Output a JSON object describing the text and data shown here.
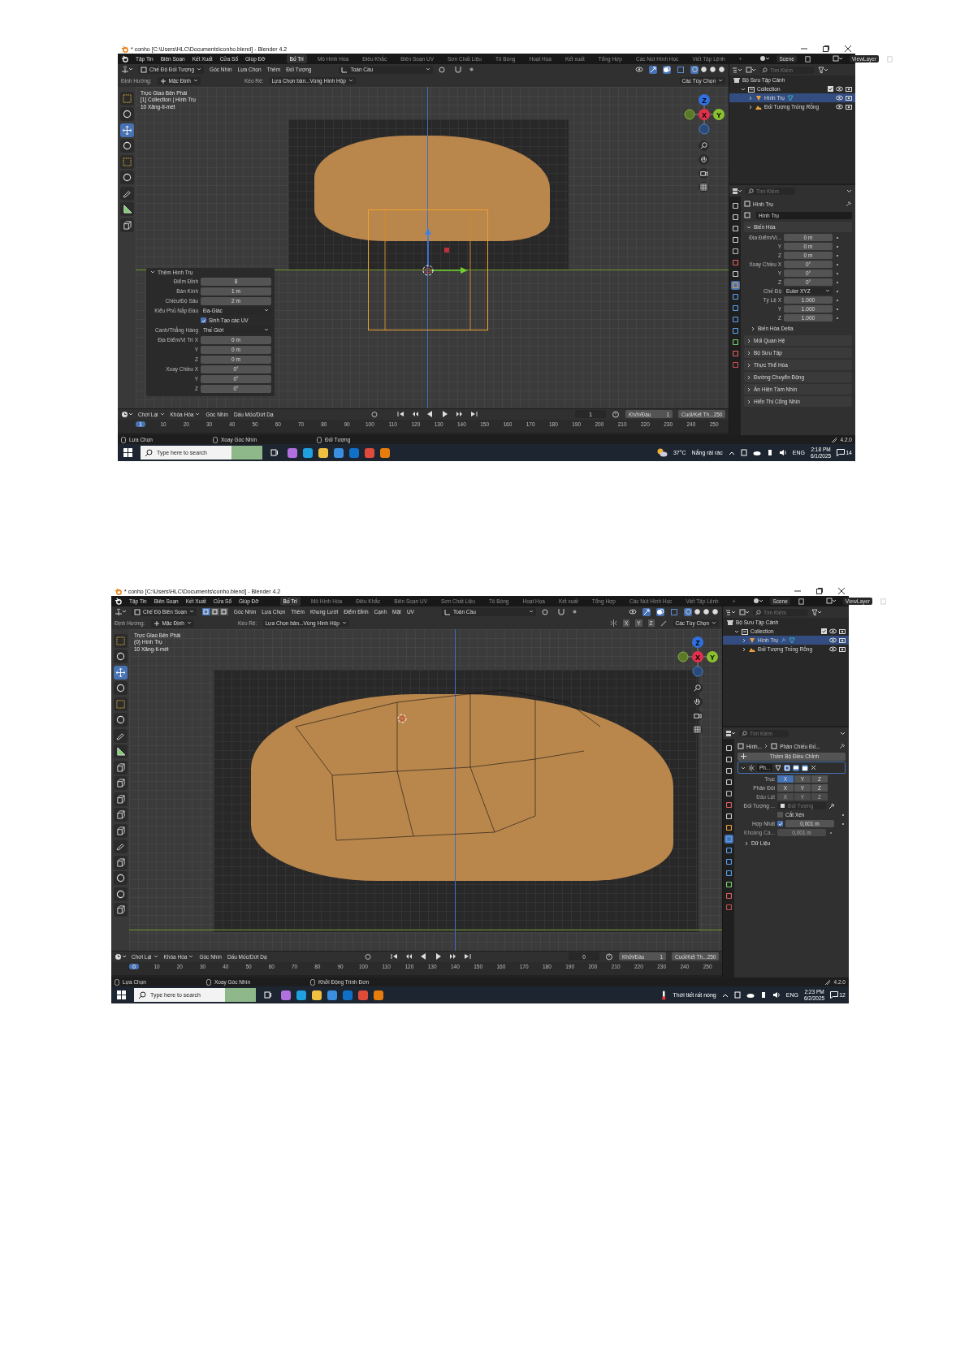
{
  "screenshots": [
    {
      "title": "* conho [C:\\Users\\HLC\\Documents\\conho.blend] - Blender 4.2",
      "menus": [
        "Tập Tin",
        "Biên Soạn",
        "Kết Xuất",
        "Cửa Sổ",
        "Giúp Đỡ"
      ],
      "workspaces": [
        {
          "label": "Bố Trí",
          "selected": true
        },
        {
          "label": "Mô Hình Hóa",
          "selected": false
        },
        {
          "label": "Điêu Khắc",
          "selected": false
        },
        {
          "label": "Biên Soạn UV",
          "selected": false
        },
        {
          "label": "Sơn Chất Liệu",
          "selected": false
        },
        {
          "label": "Tô Bóng",
          "selected": false
        },
        {
          "label": "Hoạt Họa",
          "selected": false
        },
        {
          "label": "Kết xuất",
          "selected": false
        },
        {
          "label": "Tổng Hợp",
          "selected": false
        },
        {
          "label": "Các Nút Hình Học",
          "selected": false
        },
        {
          "label": "Viết Tập Lệnh",
          "selected": false
        },
        {
          "label": "+",
          "selected": false
        }
      ],
      "scene": "Scene",
      "view_layer": "ViewLayer",
      "mode": "Chế Độ Đối Tượng",
      "header_menus": [
        "Góc Nhìn",
        "Lựa Chọn",
        "Thêm",
        "Đối Tượng"
      ],
      "orientation": "Toàn Cầu",
      "shading": [
        {
          "selected": true
        },
        {
          "selected": false
        },
        {
          "selected": false
        },
        {
          "selected": false
        }
      ],
      "tool_settings": {
        "orientation_label": "Định Hướng:",
        "orientation": "Mặc Định",
        "drag_label": "Kéo Rê:",
        "drag": "Lựa Chọn bản...Vùng Hình Hộp",
        "options": "Các Tùy Chọn"
      },
      "overlay_text": [
        "Trực Giao Bên Phải",
        "[1] Collection | Hình Trụ",
        "10 Xăng-ti-mét"
      ],
      "tools": [
        {
          "kind": "select",
          "selected": false
        },
        {
          "kind": "cursor",
          "selected": false
        },
        {
          "kind": "move",
          "selected": true
        },
        {
          "kind": "rotate",
          "selected": false
        },
        {
          "kind": "scale",
          "selected": false
        },
        {
          "kind": "transform",
          "selected": false
        },
        {
          "kind": "annotate",
          "selected": false
        },
        {
          "kind": "measure",
          "selected": false
        },
        {
          "kind": "add",
          "selected": false
        }
      ],
      "viewport": {
        "kind": "object"
      },
      "gizmo": [
        "X",
        "Y",
        "Z"
      ],
      "operator_panel": {
        "title": "Thêm Hình Trụ",
        "expanded": true,
        "rows": [
          {
            "kind": "field",
            "label": "Điểm Đỉnh",
            "value": "8"
          },
          {
            "kind": "field",
            "label": "Bán Kính",
            "value": "1 m"
          },
          {
            "kind": "field",
            "label": "Chiều/Độ Sâu",
            "value": "2 m"
          },
          {
            "kind": "select",
            "label": "Kiểu Phủ Nắp Đầu",
            "value": "Đa-Giác"
          },
          {
            "kind": "check",
            "label": "Sinh Tạo các UV",
            "checked": true
          },
          {
            "kind": "select",
            "label": "Canh/Thẳng Hàng",
            "value": "Thế Giới"
          },
          {
            "kind": "field",
            "label": "Địa Điểm/Vị Trí X",
            "value": "0 m"
          },
          {
            "kind": "field",
            "label": "Y",
            "value": "0 m"
          },
          {
            "kind": "field",
            "label": "Z",
            "value": "0 m"
          },
          {
            "kind": "field",
            "label": "Xoay Chiều X",
            "value": "0°"
          },
          {
            "kind": "field",
            "label": "Y",
            "value": "0°"
          },
          {
            "kind": "field",
            "label": "Z",
            "value": "0°"
          }
        ]
      },
      "outliner": {
        "search": "Tìm Kiếm",
        "items": [
          {
            "label": "Bộ Sưu Tập Cảnh",
            "kind": "scene",
            "selected": false,
            "children": [
              {
                "label": "Collection",
                "kind": "collection",
                "expanded": true,
                "checked": true,
                "selected": false,
                "children": [
                  {
                    "label": "Hình Trụ",
                    "kind": "mesh",
                    "expanded": false,
                    "selected": true,
                    "modifier": false
                  },
                  {
                    "label": "Đối Tượng Trống Rỗng",
                    "kind": "empty",
                    "expanded": false,
                    "selected": false
                  }
                ]
              }
            ]
          }
        ]
      },
      "properties": {
        "search": "Tìm Kiếm",
        "breadcrumb": [
          "Hình Trụ"
        ],
        "tabs": [
          {
            "selected": false
          },
          {
            "selected": false
          },
          {
            "selected": false
          },
          {
            "selected": false
          },
          {
            "selected": false
          },
          {
            "selected": false
          },
          {
            "selected": false
          },
          {
            "selected": true
          },
          {
            "selected": false
          },
          {
            "selected": false
          },
          {
            "selected": false
          },
          {
            "selected": false
          },
          {
            "selected": false
          },
          {
            "selected": false
          },
          {
            "selected": false
          }
        ],
        "rows": [
          {
            "kind": "name",
            "value": "Hình Trụ"
          },
          {
            "kind": "panel",
            "label": "Biến Hóa",
            "expanded": true
          },
          {
            "kind": "field",
            "label": "Địa Điểm/Vị...",
            "value": "0 m"
          },
          {
            "kind": "field",
            "label": "Y",
            "value": "0 m"
          },
          {
            "kind": "field",
            "label": "Z",
            "value": "0 m"
          },
          {
            "kind": "field",
            "label": "Xoay Chiều X",
            "value": "0°"
          },
          {
            "kind": "field",
            "label": "Y",
            "value": "0°"
          },
          {
            "kind": "field",
            "label": "Z",
            "value": "0°"
          },
          {
            "kind": "select",
            "label": "Chế Độ",
            "value": "Euler XYZ"
          },
          {
            "kind": "field",
            "label": "Tỷ Lệ X",
            "value": "1.000"
          },
          {
            "kind": "field",
            "label": "Y",
            "value": "1.000"
          },
          {
            "kind": "field",
            "label": "Z",
            "value": "1.000"
          },
          {
            "kind": "subpanel",
            "label": "Biến Hóa Delta",
            "expanded": false
          },
          {
            "kind": "panel",
            "label": "Mối Quan Hệ",
            "expanded": false
          },
          {
            "kind": "panel",
            "label": "Bộ Sưu Tập",
            "expanded": false
          },
          {
            "kind": "panel",
            "label": "Thực Thể Hóa",
            "expanded": false
          },
          {
            "kind": "panel",
            "label": "Đường Chuyển Động",
            "expanded": false
          },
          {
            "kind": "panel",
            "label": "Ẩn Hiện Tầm Nhìn",
            "expanded": false
          },
          {
            "kind": "panel",
            "label": "Hiển Thị Cổng Nhìn",
            "expanded": false
          }
        ]
      },
      "timeline": {
        "menus": [
          {
            "label": "Chơi Lại",
            "dropdown": true
          },
          {
            "label": "Khóa Hóa",
            "dropdown": true
          },
          {
            "label": "Góc Nhìn",
            "dropdown": false
          },
          {
            "label": "Dấu Mốc/Dứt Dạ",
            "dropdown": false
          }
        ],
        "current_frame": "1",
        "start_label": "Khởi/Đầu",
        "start": "1",
        "end_label": "Cuối/Kết Th...",
        "end": "250",
        "ruler": [
          {
            "label": "1",
            "selected": true
          },
          {
            "label": "10",
            "selected": false
          },
          {
            "label": "20",
            "selected": false
          },
          {
            "label": "30",
            "selected": false
          },
          {
            "label": "40",
            "selected": false
          },
          {
            "label": "50",
            "selected": false
          },
          {
            "label": "60",
            "selected": false
          },
          {
            "label": "70",
            "selected": false
          },
          {
            "label": "80",
            "selected": false
          },
          {
            "label": "90",
            "selected": false
          },
          {
            "label": "100",
            "selected": false
          },
          {
            "label": "110",
            "selected": false
          },
          {
            "label": "120",
            "selected": false
          },
          {
            "label": "130",
            "selected": false
          },
          {
            "label": "140",
            "selected": false
          },
          {
            "label": "150",
            "selected": false
          },
          {
            "label": "160",
            "selected": false
          },
          {
            "label": "170",
            "selected": false
          },
          {
            "label": "180",
            "selected": false
          },
          {
            "label": "190",
            "selected": false
          },
          {
            "label": "200",
            "selected": false
          },
          {
            "label": "210",
            "selected": false
          },
          {
            "label": "220",
            "selected": false
          },
          {
            "label": "230",
            "selected": false
          },
          {
            "label": "240",
            "selected": false
          },
          {
            "label": "250",
            "selected": false
          }
        ]
      },
      "status_bar": {
        "items": [
          "Lựa Chọn",
          "Xoay Góc Nhìn",
          "Đối Tượng"
        ],
        "version": "4.2.0"
      },
      "taskbar": {
        "search_placeholder": "Type here to search",
        "temperature": "37°C",
        "weather": "Nắng rải rác",
        "language": "ENG",
        "time": "2:18 PM",
        "date": "6/1/2025",
        "notifications": "14"
      }
    },
    {
      "title": "* conho [C:\\Users\\HLC\\Documents\\conho.blend] - Blender 4.2",
      "menus": [
        "Tập Tin",
        "Biên Soạn",
        "Kết Xuất",
        "Cửa Sổ",
        "Giúp Đỡ"
      ],
      "workspaces": [
        {
          "label": "Bố Trí",
          "selected": true
        },
        {
          "label": "Mô Hình Hóa",
          "selected": false
        },
        {
          "label": "Điêu Khắc",
          "selected": false
        },
        {
          "label": "Biên Soạn UV",
          "selected": false
        },
        {
          "label": "Sơn Chất Liệu",
          "selected": false
        },
        {
          "label": "Tô Bóng",
          "selected": false
        },
        {
          "label": "Hoạt Họa",
          "selected": false
        },
        {
          "label": "Kết xuất",
          "selected": false
        },
        {
          "label": "Tổng Hợp",
          "selected": false
        },
        {
          "label": "Các Nút Hình Học",
          "selected": false
        },
        {
          "label": "Viết Tập Lệnh",
          "selected": false
        },
        {
          "label": "+",
          "selected": false
        }
      ],
      "scene": "Scene",
      "view_layer": "ViewLayer",
      "mode": "Chế Độ Biên Soạn",
      "select_modes": [
        {
          "selected": true
        },
        {
          "selected": false
        },
        {
          "selected": false
        }
      ],
      "header_menus": [
        "Góc Nhìn",
        "Lựa Chọn",
        "Thêm",
        "Khung Lưới",
        "Điểm Đỉnh",
        "Cạnh",
        "Mặt",
        "UV"
      ],
      "orientation": "Toàn Cầu",
      "shading": [
        {
          "selected": true
        },
        {
          "selected": false
        },
        {
          "selected": false
        },
        {
          "selected": false
        }
      ],
      "tool_settings": {
        "orientation_label": "Định Hướng:",
        "orientation": "Mặc Định",
        "drag_label": "Kéo Rê:",
        "drag": "Lựa Chọn bản...Vùng Hình Hộp",
        "mirror_axes": [
          "X",
          "Y",
          "Z"
        ],
        "options": "Các Tùy Chọn"
      },
      "overlay_text": [
        "Trực Giao Bên Phải",
        "(0) Hình Trụ",
        "10 Xăng-ti-mét"
      ],
      "tools": [
        {
          "kind": "select",
          "selected": false
        },
        {
          "kind": "cursor",
          "selected": false
        },
        {
          "kind": "move",
          "selected": true
        },
        {
          "kind": "rotate",
          "selected": false
        },
        {
          "kind": "scale",
          "selected": false
        },
        {
          "kind": "transform",
          "selected": false
        },
        {
          "kind": "annotate",
          "selected": false
        },
        {
          "kind": "measure",
          "selected": false
        },
        {
          "kind": "add",
          "selected": false
        },
        {
          "kind": "extrude",
          "selected": false
        },
        {
          "kind": "inset",
          "selected": false
        },
        {
          "kind": "bevel",
          "selected": false
        },
        {
          "kind": "loopcut",
          "selected": false
        },
        {
          "kind": "knife",
          "selected": false
        },
        {
          "kind": "polybuild",
          "selected": false
        },
        {
          "kind": "spin",
          "selected": false
        },
        {
          "kind": "smooth",
          "selected": false
        },
        {
          "kind": "shrink",
          "selected": false
        }
      ],
      "viewport": {
        "kind": "edit"
      },
      "gizmo": [
        "X",
        "Y",
        "Z"
      ],
      "outliner": {
        "search": "Tìm Kiếm",
        "items": [
          {
            "label": "Bộ Sưu Tập Cảnh",
            "kind": "scene",
            "selected": false,
            "children": [
              {
                "label": "Collection",
                "kind": "collection",
                "expanded": true,
                "checked": true,
                "selected": false,
                "children": [
                  {
                    "label": "Hình Trụ",
                    "kind": "mesh",
                    "expanded": false,
                    "selected": true,
                    "modifier": true
                  },
                  {
                    "label": "Đối Tượng Trống Rỗng",
                    "kind": "empty",
                    "expanded": false,
                    "selected": false
                  }
                ]
              }
            ]
          }
        ]
      },
      "properties": {
        "search": "Tìm Kiếm",
        "breadcrumb": [
          "Hình...",
          "Phản Chiếu Đố..."
        ],
        "tabs": [
          {
            "selected": false
          },
          {
            "selected": false
          },
          {
            "selected": false
          },
          {
            "selected": false
          },
          {
            "selected": false
          },
          {
            "selected": false
          },
          {
            "selected": false
          },
          {
            "selected": false
          },
          {
            "selected": true
          },
          {
            "selected": false
          },
          {
            "selected": false
          },
          {
            "selected": false
          },
          {
            "selected": false
          },
          {
            "selected": false
          },
          {
            "selected": false
          }
        ],
        "rows": [
          {
            "kind": "add",
            "label": "Thêm Bộ Điều Chỉnh"
          },
          {
            "kind": "modifier",
            "label": "Ph...",
            "expanded": true
          },
          {
            "kind": "axes",
            "label": "Trục",
            "disabled": false,
            "buttons": [
              {
                "label": "X",
                "selected": true
              },
              {
                "label": "Y",
                "selected": false
              },
              {
                "label": "Z",
                "selected": false
              }
            ]
          },
          {
            "kind": "axes",
            "label": "Phân Đôi",
            "disabled": false,
            "buttons": [
              {
                "label": "X",
                "selected": false
              },
              {
                "label": "Y",
                "selected": false
              },
              {
                "label": "Z",
                "selected": false
              }
            ]
          },
          {
            "kind": "axes",
            "label": "Đảo Lật",
            "disabled": true,
            "buttons": [
              {
                "label": "X",
                "selected": false
              },
              {
                "label": "Y",
                "selected": false
              },
              {
                "label": "Z",
                "selected": false
              }
            ]
          },
          {
            "kind": "object",
            "label": "Đối Tượng ...",
            "placeholder": "Đối Tượng"
          },
          {
            "kind": "check",
            "label": "Cắt Xén",
            "checked": false
          },
          {
            "kind": "check_field",
            "label": "Hợp Nhất",
            "checked": true,
            "value": "0,001 m"
          },
          {
            "kind": "field",
            "label": "Khoảng Cá...",
            "value": "0,001 m",
            "disabled": true
          },
          {
            "kind": "subpanel",
            "label": "Dữ Liệu",
            "expanded": false
          }
        ]
      },
      "timeline": {
        "menus": [
          {
            "label": "Chơi Lại",
            "dropdown": true
          },
          {
            "label": "Khóa Hóa",
            "dropdown": true
          },
          {
            "label": "Góc Nhìn",
            "dropdown": false
          },
          {
            "label": "Dấu Mốc/Dứt Dạ",
            "dropdown": false
          }
        ],
        "current_frame": "0",
        "start_label": "Khởi/Đầu",
        "start": "1",
        "end_label": "Cuối/Kết Th...",
        "end": "250",
        "ruler": [
          {
            "label": "0",
            "selected": true
          },
          {
            "label": "10",
            "selected": false
          },
          {
            "label": "20",
            "selected": false
          },
          {
            "label": "30",
            "selected": false
          },
          {
            "label": "40",
            "selected": false
          },
          {
            "label": "50",
            "selected": false
          },
          {
            "label": "60",
            "selected": false
          },
          {
            "label": "70",
            "selected": false
          },
          {
            "label": "80",
            "selected": false
          },
          {
            "label": "90",
            "selected": false
          },
          {
            "label": "100",
            "selected": false
          },
          {
            "label": "110",
            "selected": false
          },
          {
            "label": "120",
            "selected": false
          },
          {
            "label": "130",
            "selected": false
          },
          {
            "label": "140",
            "selected": false
          },
          {
            "label": "150",
            "selected": false
          },
          {
            "label": "160",
            "selected": false
          },
          {
            "label": "170",
            "selected": false
          },
          {
            "label": "180",
            "selected": false
          },
          {
            "label": "190",
            "selected": false
          },
          {
            "label": "200",
            "selected": false
          },
          {
            "label": "210",
            "selected": false
          },
          {
            "label": "220",
            "selected": false
          },
          {
            "label": "230",
            "selected": false
          },
          {
            "label": "240",
            "selected": false
          },
          {
            "label": "250",
            "selected": false
          }
        ]
      },
      "status_bar": {
        "items": [
          "Lựa Chọn",
          "Xoay Góc Nhìn",
          "Khởi Động Trình Đơn"
        ],
        "version": "4.2.0"
      },
      "taskbar": {
        "search_placeholder": "Type here to search",
        "weather": "Thời tiết rất nóng",
        "language": "ENG",
        "time": "2:23 PM",
        "date": "6/2/2025",
        "notifications": "12"
      }
    }
  ]
}
